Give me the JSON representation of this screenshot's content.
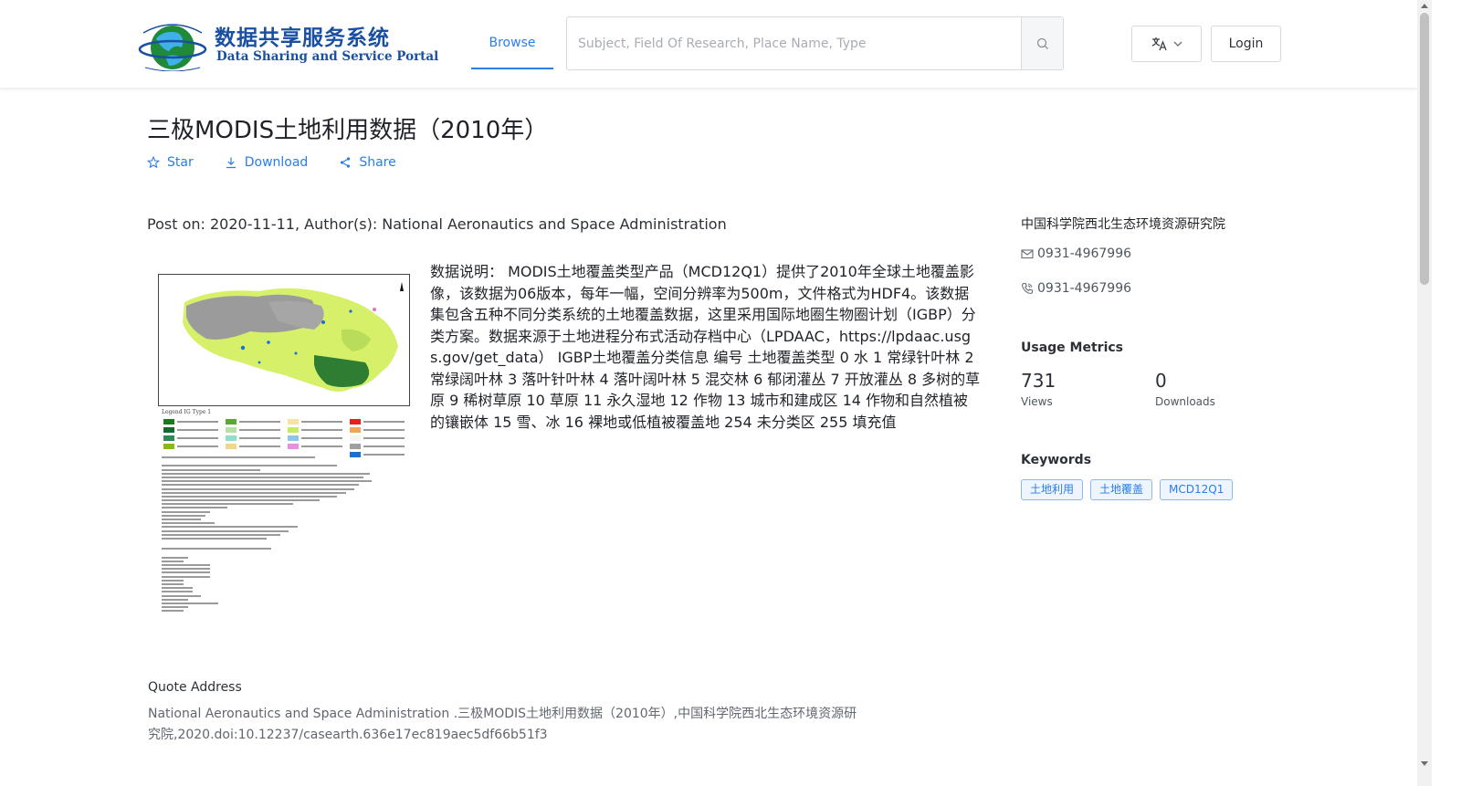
{
  "header": {
    "logo": {
      "title_cn": "数据共享服务系统",
      "title_en": "Data Sharing and Service Portal",
      "icon": "globe-logo-icon"
    },
    "nav": {
      "browse_label": "Browse"
    },
    "search": {
      "placeholder": "Subject, Field Of Research, Place Name, Type",
      "value": "",
      "icon": "search-icon"
    },
    "language": {
      "icon": "translate-icon",
      "dropdown_icon": "chevron-down-icon"
    },
    "login_label": "Login"
  },
  "dataset": {
    "title": "三极MODIS土地利用数据（2010年）",
    "actions": [
      {
        "label": "Star",
        "icon": "star-icon"
      },
      {
        "label": "Download",
        "icon": "download-icon"
      },
      {
        "label": "Share",
        "icon": "share-icon"
      }
    ],
    "post_info": "Post on: 2020-11-11, Author(s): National Aeronautics and Space Administration",
    "description": "数据说明： MODIS土地覆盖类型产品（MCD12Q1）提供了2010年全球土地覆盖影像，该数据为06版本，每年一幅，空间分辨率为500m，文件格式为HDF4。该数据集包含五种不同分类系统的土地覆盖数据，这里采用国际地圈生物圈计划（IGBP）分类方案。数据来源于土地进程分布式活动存档中心（LPDAAC，https://lpdaac.usgs.gov/get_data） IGBP土地覆盖分类信息 编号 土地覆盖类型 0 水 1 常绿针叶林 2 常绿阔叶林 3 落叶针叶林 4 落叶阔叶林 5 混交林 6 郁闭灌丛 7 开放灌丛 8 多树的草原 9 稀树草原 10 草原 11 永久湿地 12 作物 13 城市和建成区 14 作物和自然植被的镶嵌体 15 雪、冰 16 裸地或低植被覆盖地 254 未分类区 255 填充值",
    "thumbnail": {
      "legend_title": "Legend IG Type 1",
      "colors": {
        "land": "#d6f06a",
        "barren": "#9b9b9b",
        "water": "#1a6fd6",
        "forest": "#2e7d32"
      }
    }
  },
  "sidebar": {
    "organization": "中国科学院西北生态环境资源研究院",
    "email": {
      "value": "0931-4967996",
      "icon": "mail-icon"
    },
    "phone": {
      "value": "0931-4967996",
      "icon": "phone-icon"
    },
    "usage_metrics": {
      "title": "Usage Metrics",
      "views": {
        "value": "731",
        "label": "Views"
      },
      "downloads": {
        "value": "0",
        "label": "Downloads"
      }
    },
    "keywords": {
      "title": "Keywords",
      "items": [
        "土地利用",
        "土地覆盖",
        "MCD12Q1"
      ]
    }
  },
  "quote": {
    "title": "Quote Address",
    "text": "National Aeronautics and Space Administration .三极MODIS土地利用数据（2010年）,中国科学院西北生态环境资源研究院,2020.doi:10.12237/casearth.636e17ec819aec5df66b51f3"
  },
  "colors": {
    "accent": "#2b7de9",
    "logo_blue": "#1a4fa3"
  }
}
